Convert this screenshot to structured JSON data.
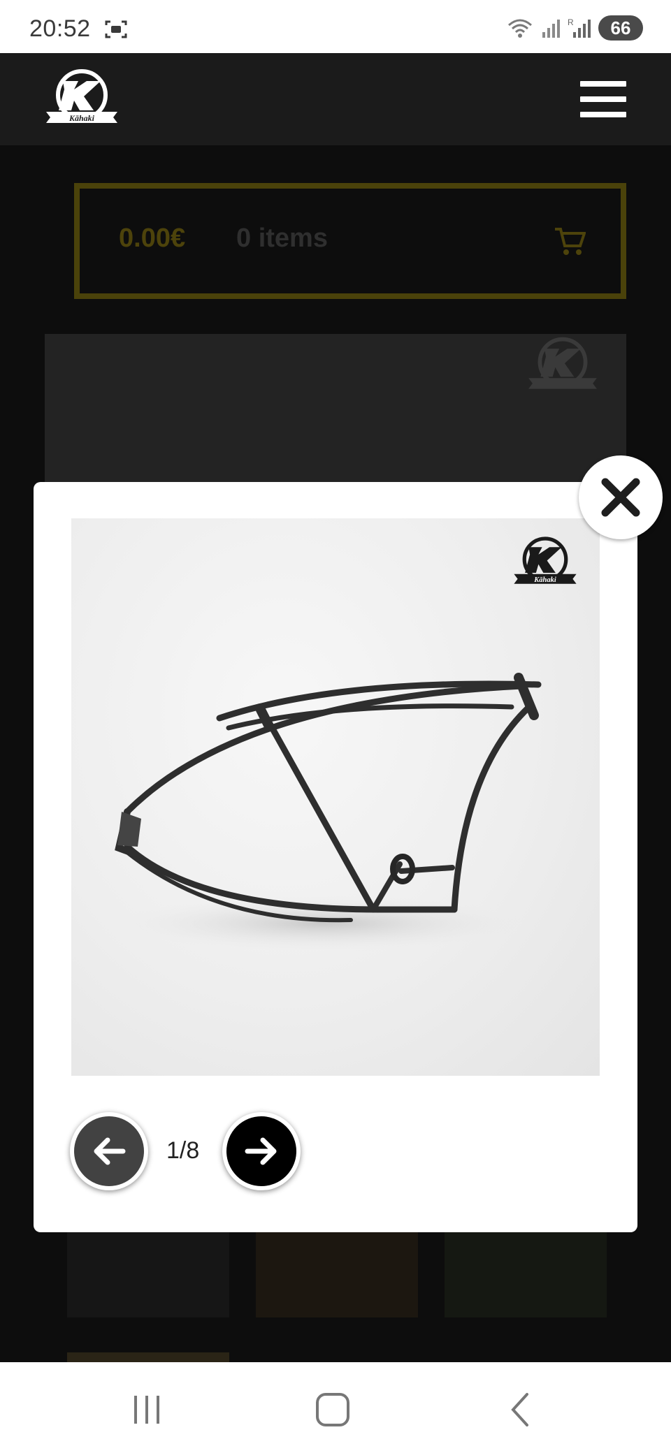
{
  "status_bar": {
    "time": "20:52",
    "battery": "66",
    "icons": [
      "screenshot-icon",
      "wifi-icon",
      "signal-icon",
      "signal-roaming-icon",
      "battery-icon"
    ]
  },
  "header": {
    "logo_text": "Kāhaki",
    "menu_icon": "hamburger-menu-icon"
  },
  "cart": {
    "total": "0.00€",
    "count": "0 items",
    "icon": "cart-icon",
    "accent_color": "#4a420a"
  },
  "lightbox": {
    "counter": "1/8",
    "close_icon": "close-icon",
    "prev_icon": "arrow-left-icon",
    "next_icon": "arrow-right-icon",
    "watermark_text": "Kāhaki"
  },
  "system_nav": {
    "recents_icon": "recents-icon",
    "home_icon": "home-icon",
    "back_icon": "back-icon"
  }
}
